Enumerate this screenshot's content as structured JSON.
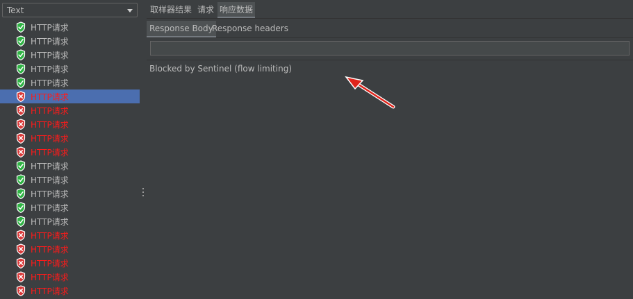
{
  "left": {
    "filter_dropdown": {
      "value": "Text"
    },
    "results": [
      {
        "label": "HTTP请求",
        "status": "success"
      },
      {
        "label": "HTTP请求",
        "status": "success"
      },
      {
        "label": "HTTP请求",
        "status": "success"
      },
      {
        "label": "HTTP请求",
        "status": "success"
      },
      {
        "label": "HTTP请求",
        "status": "success"
      },
      {
        "label": "HTTP请求",
        "status": "failure",
        "selected": true
      },
      {
        "label": "HTTP请求",
        "status": "failure"
      },
      {
        "label": "HTTP请求",
        "status": "failure"
      },
      {
        "label": "HTTP请求",
        "status": "failure"
      },
      {
        "label": "HTTP请求",
        "status": "failure"
      },
      {
        "label": "HTTP请求",
        "status": "success"
      },
      {
        "label": "HTTP请求",
        "status": "success"
      },
      {
        "label": "HTTP请求",
        "status": "success"
      },
      {
        "label": "HTTP请求",
        "status": "success"
      },
      {
        "label": "HTTP请求",
        "status": "success"
      },
      {
        "label": "HTTP请求",
        "status": "failure"
      },
      {
        "label": "HTTP请求",
        "status": "failure"
      },
      {
        "label": "HTTP请求",
        "status": "failure"
      },
      {
        "label": "HTTP请求",
        "status": "failure"
      },
      {
        "label": "HTTP请求",
        "status": "failure"
      }
    ]
  },
  "right": {
    "tabs": [
      {
        "label": "取样器结果",
        "active": false
      },
      {
        "label": "请求",
        "active": false
      },
      {
        "label": "响应数据",
        "active": true
      }
    ],
    "subtabs": [
      {
        "label": "Response Body",
        "active": true
      },
      {
        "label": "Response headers",
        "active": false
      }
    ],
    "search_field": {
      "value": ""
    },
    "response_body": "Blocked by Sentinel (flow limiting)"
  },
  "colors": {
    "success_icon": "#2fb344",
    "failure_icon": "#d93a3a",
    "failure_text": "#ff1a1a",
    "selected_row": "#4b6eaf",
    "annotation_arrow": "#e0241b"
  },
  "icons": {
    "success": "shield-check-icon",
    "failure": "shield-x-icon",
    "dropdown": "chevron-down-icon",
    "annotation": "red-arrow-icon"
  }
}
